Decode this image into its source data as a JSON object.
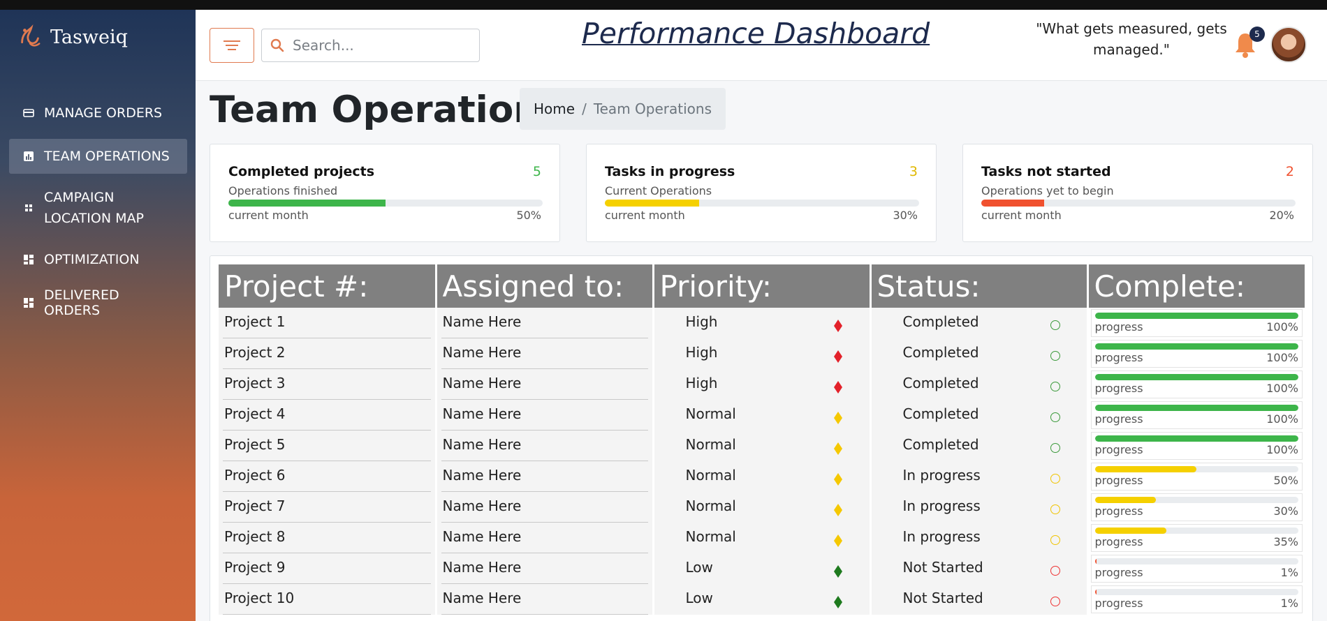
{
  "sidebar": {
    "brand": "Tasweiq",
    "items": [
      {
        "label": "MANAGE ORDERS",
        "icon": "card-icon"
      },
      {
        "label": "TEAM OPERATIONS",
        "icon": "bar-chart-icon"
      },
      {
        "label": "CAMPAIGN LOCATION MAP",
        "icon": "grid-icon"
      },
      {
        "label": "OPTIMIZATION",
        "icon": "dashboard-icon"
      },
      {
        "label": "DELIVERED ORDERS",
        "icon": "dashboard-icon"
      }
    ],
    "campaign_line1": "CAMPAIGN",
    "campaign_line2": "LOCATION MAP"
  },
  "header": {
    "search_placeholder": "Search...",
    "dashboard_title": "Performance Dashboard",
    "quote": "\"What gets measured, gets managed.\"",
    "notification_count": "5"
  },
  "page": {
    "title": "Team Operations",
    "breadcrumb_home": "Home",
    "breadcrumb_sep": "/",
    "breadcrumb_current": "Team Operations"
  },
  "cards": [
    {
      "title": "Completed projects",
      "count": "5",
      "subtitle": "Operations finished",
      "period": "current month",
      "percent_label": "50%",
      "fraction": 0.5,
      "color": "#3db54a"
    },
    {
      "title": "Tasks in progress",
      "count": "3",
      "subtitle": "Current Operations",
      "period": "current month",
      "percent_label": "30%",
      "fraction": 0.3,
      "color": "#f5d000"
    },
    {
      "title": "Tasks not started",
      "count": "2",
      "subtitle": "Operations yet to begin",
      "period": "current month",
      "percent_label": "20%",
      "fraction": 0.2,
      "color": "#f0512f"
    }
  ],
  "table": {
    "headers": [
      "Project #:",
      "Assigned to:",
      "Priority:",
      "Status:",
      "Complete:"
    ],
    "progress_label": "progress",
    "rows": [
      {
        "project": "Project 1",
        "assignee": "Name Here",
        "priority": "High",
        "priority_color": "#e3212a",
        "status": "Completed",
        "status_color": "#3a9a3a",
        "percent_label": "100%",
        "fraction": 1.0,
        "bar_color": "#3db54a"
      },
      {
        "project": "Project 2",
        "assignee": "Name Here",
        "priority": "High",
        "priority_color": "#e3212a",
        "status": "Completed",
        "status_color": "#3a9a3a",
        "percent_label": "100%",
        "fraction": 1.0,
        "bar_color": "#3db54a"
      },
      {
        "project": "Project 3",
        "assignee": "Name Here",
        "priority": "High",
        "priority_color": "#e3212a",
        "status": "Completed",
        "status_color": "#3a9a3a",
        "percent_label": "100%",
        "fraction": 1.0,
        "bar_color": "#3db54a"
      },
      {
        "project": "Project 4",
        "assignee": "Name Here",
        "priority": "Normal",
        "priority_color": "#f5c800",
        "status": "Completed",
        "status_color": "#3a9a3a",
        "percent_label": "100%",
        "fraction": 1.0,
        "bar_color": "#3db54a"
      },
      {
        "project": "Project 5",
        "assignee": "Name Here",
        "priority": "Normal",
        "priority_color": "#f5c800",
        "status": "Completed",
        "status_color": "#3a9a3a",
        "percent_label": "100%",
        "fraction": 1.0,
        "bar_color": "#3db54a"
      },
      {
        "project": "Project 6",
        "assignee": "Name Here",
        "priority": "Normal",
        "priority_color": "#f5c800",
        "status": "In progress",
        "status_color": "#f0c400",
        "percent_label": "50%",
        "fraction": 0.5,
        "bar_color": "#f5d000"
      },
      {
        "project": "Project 7",
        "assignee": "Name Here",
        "priority": "Normal",
        "priority_color": "#f5c800",
        "status": "In progress",
        "status_color": "#f0c400",
        "percent_label": "30%",
        "fraction": 0.3,
        "bar_color": "#f5d000"
      },
      {
        "project": "Project 8",
        "assignee": "Name Here",
        "priority": "Normal",
        "priority_color": "#f5c800",
        "status": "In progress",
        "status_color": "#f0c400",
        "percent_label": "35%",
        "fraction": 0.35,
        "bar_color": "#f5d000"
      },
      {
        "project": "Project 9",
        "assignee": "Name Here",
        "priority": "Low",
        "priority_color": "#1e7a1e",
        "status": "Not Started",
        "status_color": "#e33",
        "percent_label": "1%",
        "fraction": 0.01,
        "bar_color": "#f0512f"
      },
      {
        "project": "Project 10",
        "assignee": "Name Here",
        "priority": "Low",
        "priority_color": "#1e7a1e",
        "status": "Not Started",
        "status_color": "#e33",
        "percent_label": "1%",
        "fraction": 0.01,
        "bar_color": "#f0512f"
      }
    ]
  },
  "colors": {
    "accent": "#e07a4f",
    "header_cell": "#808080",
    "title_navy": "#1d2a4d"
  }
}
